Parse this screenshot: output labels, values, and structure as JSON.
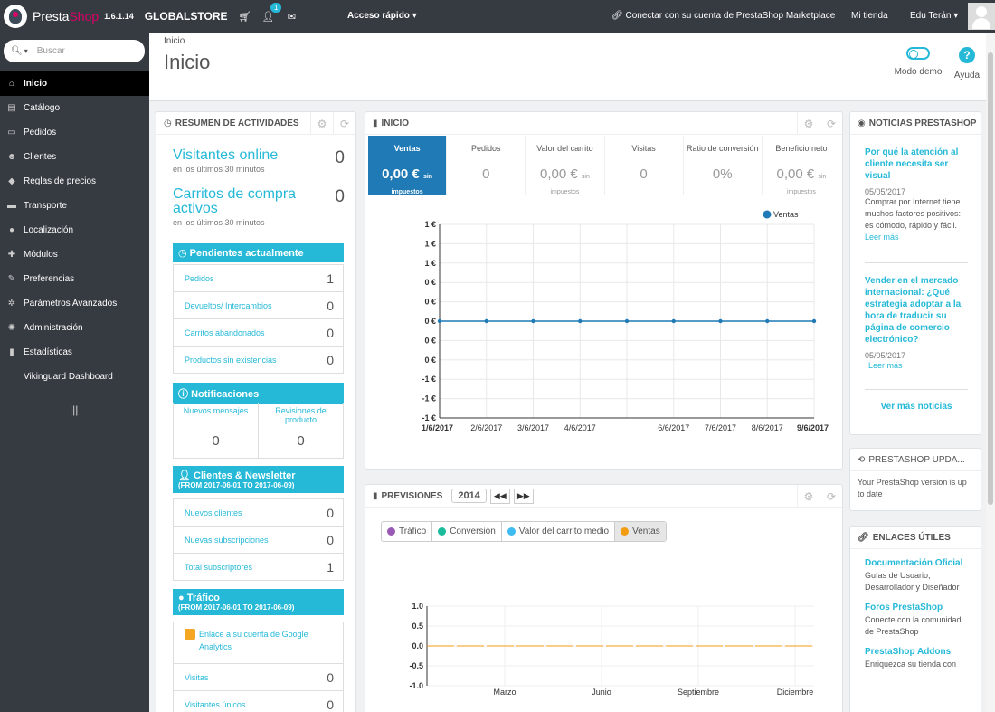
{
  "topbar": {
    "brand_part1": "Presta",
    "brand_part2": "Shop",
    "version": "1.6.1.14",
    "store": "GLOBALSTORE",
    "notif_count": "1",
    "quick_access": "Acceso rápido",
    "marketplace": "Conectar con su cuenta de PrestaShop Marketplace",
    "my_shop": "Mi tienda",
    "user": "Edu Terán"
  },
  "sidebar": {
    "search_placeholder": "Buscar",
    "items": [
      {
        "label": "Inicio",
        "icon": "home-icon",
        "glyph": "⌂"
      },
      {
        "label": "Catálogo",
        "icon": "book-icon",
        "glyph": "▤"
      },
      {
        "label": "Pedidos",
        "icon": "credit-card-icon",
        "glyph": "▭"
      },
      {
        "label": "Clientes",
        "icon": "users-icon",
        "glyph": "☻"
      },
      {
        "label": "Reglas de precios",
        "icon": "tag-icon",
        "glyph": "◆"
      },
      {
        "label": "Transporte",
        "icon": "truck-icon",
        "glyph": "▬"
      },
      {
        "label": "Localización",
        "icon": "globe-icon",
        "glyph": "●"
      },
      {
        "label": "Módulos",
        "icon": "puzzle-icon",
        "glyph": "✚"
      },
      {
        "label": "Preferencias",
        "icon": "wrench-icon",
        "glyph": "✎"
      },
      {
        "label": "Parámetros Avanzados",
        "icon": "cogs-icon",
        "glyph": "✲"
      },
      {
        "label": "Administración",
        "icon": "cog-icon",
        "glyph": "✺"
      },
      {
        "label": "Estadísticas",
        "icon": "bar-chart-icon",
        "glyph": "▮"
      },
      {
        "label": "Vikinguard Dashboard",
        "icon": "",
        "glyph": ""
      }
    ]
  },
  "header": {
    "breadcrumb": "Inicio",
    "title": "Inicio",
    "demo_mode": "Modo demo",
    "help": "Ayuda"
  },
  "activity": {
    "title": "Resumen de actividades",
    "online_label": "Visitantes online",
    "online_sub": "en los últimos 30 minutos",
    "online_value": "0",
    "carts_label": "Carritos de compra activos",
    "carts_sub": "en los últimos 30 minutos",
    "carts_value": "0",
    "pending_title": "Pendientes actualmente",
    "pending": [
      {
        "label": "Pedidos",
        "value": "1"
      },
      {
        "label": "Devueltos/ Intercambios",
        "value": "0"
      },
      {
        "label": "Carritos abandonados",
        "value": "0"
      },
      {
        "label": "Productos sin existencias",
        "value": "0"
      }
    ],
    "notif_title": "Notificaciones",
    "notif_messages_label": "Nuevos mensajes",
    "notif_messages_value": "0",
    "notif_reviews_label": "Revisiones de producto",
    "notif_reviews_value": "0",
    "customers_title": "Clientes & Newsletter",
    "customers_range": "(FROM 2017-06-01 TO 2017-06-09)",
    "customers": [
      {
        "label": "Nuevos clientes",
        "value": "0"
      },
      {
        "label": "Nuevas subscripciones",
        "value": "0"
      },
      {
        "label": "Total subscriptores",
        "value": "1"
      }
    ],
    "traffic_title": "Tráfico",
    "traffic_range": "(FROM 2017-06-01 TO 2017-06-09)",
    "traffic_ga_link": "Enlace a su cuenta de Google Analytics",
    "traffic": [
      {
        "label": "Visitas",
        "value": "0"
      },
      {
        "label": "Visitantes únicos",
        "value": "0"
      }
    ]
  },
  "dashboard": {
    "title": "Inicio",
    "kpis": [
      {
        "label": "Ventas",
        "value": "0,00 €",
        "tax": "sin impuestos",
        "active": true
      },
      {
        "label": "Pedidos",
        "value": "0",
        "tax": "",
        "active": false
      },
      {
        "label": "Valor del carrito",
        "value": "0,00 €",
        "tax": "sin impuestos",
        "active": false
      },
      {
        "label": "Visitas",
        "value": "0",
        "tax": "",
        "active": false
      },
      {
        "label": "Ratio de conversión",
        "value": "0%",
        "tax": "",
        "active": false
      },
      {
        "label": "Beneficio neto",
        "value": "0,00 €",
        "tax": "sin impuestos",
        "active": false
      }
    ]
  },
  "forecast": {
    "title": "Previsiones",
    "year": "2014",
    "legend": [
      {
        "label": "Tráfico",
        "color": "#9b59b6"
      },
      {
        "label": "Conversión",
        "color": "#1abc9c"
      },
      {
        "label": "Valor del carrito medio",
        "color": "#3ebbf0"
      },
      {
        "label": "Ventas",
        "color": "#f39c12"
      }
    ]
  },
  "news": {
    "title": "Noticias PrestaShop",
    "items": [
      {
        "title": "Por qué la atención al cliente necesita ser visual",
        "date": "05/05/2017",
        "text": "Comprar por Internet tiene muchos factores positivos: es cómodo, rápido y fácil.",
        "more": "Leer más"
      },
      {
        "title": "Vender en el mercado internacional: ¿Qué estrategia adoptar a la hora de traducir su página de comercio electrónico?",
        "date": "05/05/2017",
        "text": "",
        "more": "Leer más"
      }
    ],
    "see_more": "Ver más noticias"
  },
  "update": {
    "title": "PrestaShop Upda...",
    "text": "Your PrestaShop version is up to date"
  },
  "links": {
    "title": "Enlaces útiles",
    "items": [
      {
        "title": "Documentación Oficial",
        "desc": "Guías de Usuario, Desarrollador y Diseñador"
      },
      {
        "title": "Foros PrestaShop",
        "desc": "Conecte con la comunidad de PrestaShop"
      },
      {
        "title": "PrestaShop Addons",
        "desc": "Enriquezca su tienda con"
      }
    ]
  },
  "chart_data": [
    {
      "type": "line",
      "title": "",
      "x": [
        "1/6/2017",
        "2/6/2017",
        "3/6/2017",
        "4/6/2017",
        "5/6/2017",
        "6/6/2017",
        "7/6/2017",
        "8/6/2017",
        "9/6/2017"
      ],
      "x_tick_labels": [
        "1/6/2017",
        "2/6/2017",
        "3/6/2017",
        "4/6/2017",
        "6/6/2017",
        "7/6/2017",
        "8/6/2017",
        "9/6/2017"
      ],
      "y_tick_labels": [
        "1 €",
        "1 €",
        "1 €",
        "0 €",
        "0 €",
        "0 €",
        "0 €",
        "0 €",
        "-1 €",
        "-1 €",
        "-1 €"
      ],
      "ylim": [
        -1,
        1
      ],
      "series": [
        {
          "name": "Ventas",
          "color": "#1f7ab5",
          "values": [
            0,
            0,
            0,
            0,
            0,
            0,
            0,
            0,
            0
          ]
        }
      ],
      "legend": "top-right",
      "grid": true
    },
    {
      "type": "line",
      "title": "",
      "x_tick_labels": [
        "Marzo",
        "Junio",
        "Septiembre",
        "Diciembre"
      ],
      "y_tick_labels": [
        "1.0",
        "0.5",
        "0.0",
        "-0.5",
        "-1.0"
      ],
      "ylim": [
        -1,
        1
      ],
      "series": [
        {
          "name": "Ventas",
          "color": "#f39c12",
          "style": "dashed",
          "values": [
            0,
            0,
            0,
            0,
            0,
            0,
            0,
            0,
            0,
            0,
            0,
            0
          ]
        }
      ],
      "grid": true
    }
  ]
}
